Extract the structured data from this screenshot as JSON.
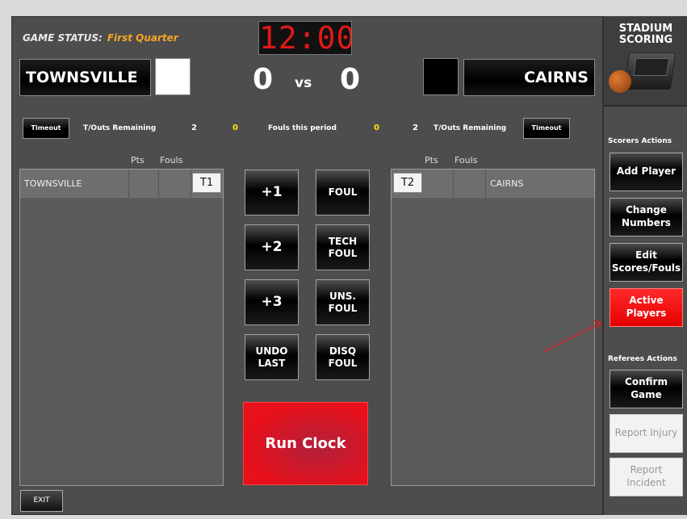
{
  "game": {
    "status_label": "GAME STATUS:",
    "status_value": "First Quarter",
    "clock": "12:00"
  },
  "home": {
    "name": "TOWNSVILLE",
    "score": "0",
    "color": "#ffffff",
    "tag": "T1",
    "timeout_label": "Timeout",
    "timeouts_label": "T/Outs Remaining",
    "timeouts_remaining": "2",
    "fouls_this_period": "0"
  },
  "away": {
    "name": "CAIRNS",
    "score": "0",
    "color": "#000000",
    "tag": "T2",
    "timeout_label": "Timeout",
    "timeouts_label": "T/Outs Remaining",
    "timeouts_remaining": "2",
    "fouls_this_period": "0"
  },
  "vs_label": "vs",
  "fouls_period_label": "Fouls this period",
  "columns": {
    "pts": "Pts",
    "fouls": "Fouls"
  },
  "actions": {
    "plus1": "+1",
    "plus2": "+2",
    "plus3": "+3",
    "undo": "UNDO\nLAST",
    "foul": "FOUL",
    "tech_foul": "TECH\nFOUL",
    "uns_foul": "UNS.\nFOUL",
    "disq_foul": "DISQ\nFOUL"
  },
  "run_clock": "Run Clock",
  "exit": "EXIT",
  "sidebar": {
    "logo": "STADIUM\nSCORING",
    "scorers_title": "Scorers Actions",
    "add_player": "Add Player",
    "change_numbers": "Change\nNumbers",
    "edit_scores": "Edit\nScores/Fouls",
    "active_players": "Active\nPlayers",
    "referees_title": "Referees Actions",
    "confirm_game": "Confirm\nGame",
    "report_injury": "Report Injury",
    "report_incident": "Report\nIncident"
  },
  "colors": {
    "accent_red": "#e60000",
    "status_orange": "#f5a623",
    "fouls_yellow": "#ffe600",
    "clock_red": "#e01818"
  }
}
